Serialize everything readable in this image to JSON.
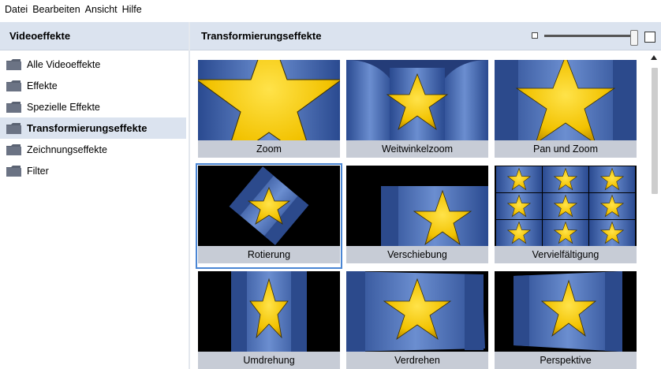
{
  "menu": [
    "Datei",
    "Bearbeiten",
    "Ansicht",
    "Hilfe"
  ],
  "left_panel": {
    "title": "Videoeffekte",
    "items": [
      {
        "label": "Alle Videoeffekte",
        "selected": false
      },
      {
        "label": "Effekte",
        "selected": false
      },
      {
        "label": "Spezielle Effekte",
        "selected": false
      },
      {
        "label": "Transformierungseffekte",
        "selected": true
      },
      {
        "label": "Zeichnungseffekte",
        "selected": false
      },
      {
        "label": "Filter",
        "selected": false
      }
    ]
  },
  "right_panel": {
    "title": "Transformierungseffekte",
    "zoom_level": 1.0
  },
  "effects": [
    {
      "label": "Zoom",
      "selected": false
    },
    {
      "label": "Weitwinkelzoom",
      "selected": false
    },
    {
      "label": "Pan und Zoom",
      "selected": false
    },
    {
      "label": "Rotierung",
      "selected": true
    },
    {
      "label": "Verschiebung",
      "selected": false
    },
    {
      "label": "Vervielfältigung",
      "selected": false
    },
    {
      "label": "Umdrehung",
      "selected": false
    },
    {
      "label": "Verdrehen",
      "selected": false
    },
    {
      "label": "Perspektive",
      "selected": false
    }
  ],
  "icons": {
    "folder": "folder-icon",
    "zoom_out": "zoom-small-icon",
    "zoom_in": "zoom-large-icon",
    "scroll_up": "arrow-up-icon"
  },
  "colors": {
    "header_bg": "#dbe3ef",
    "caption_bg": "#c7ccd6",
    "selection": "#4a86d4",
    "star": "#f5c800",
    "panel_blue": "#3d5fa5"
  }
}
